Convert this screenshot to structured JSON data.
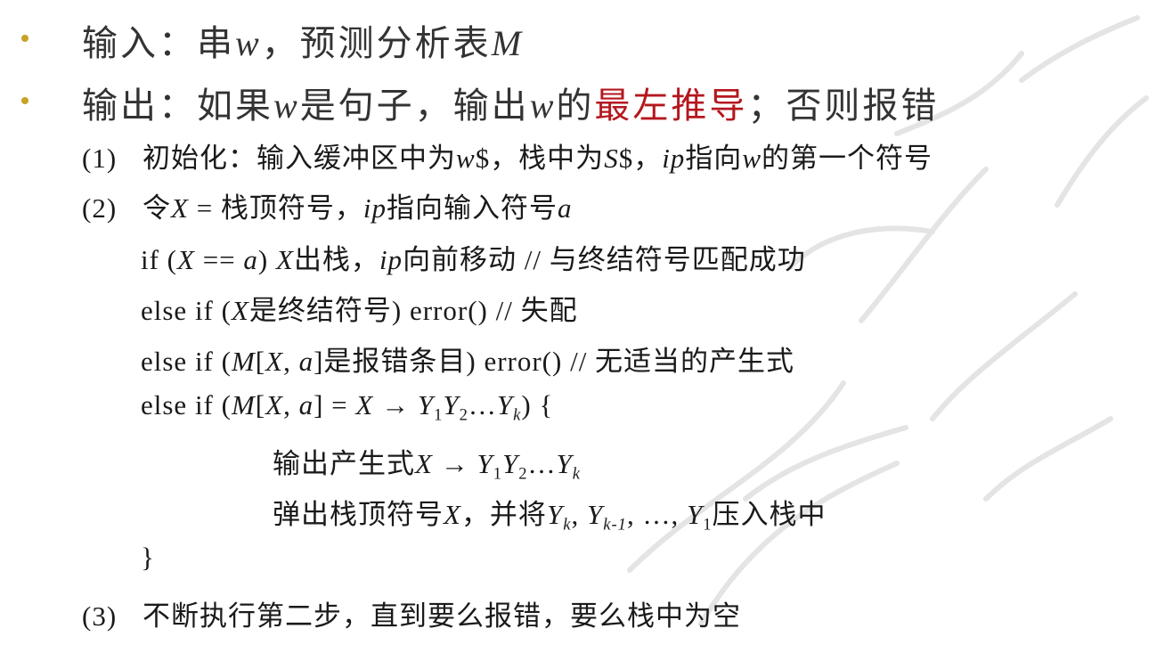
{
  "colors": {
    "bullet": "#c8a227",
    "emphasis": "#b5171e",
    "watermark": "#e4e4e4"
  },
  "bullets": [
    {
      "parts": [
        "输入：串",
        "w",
        "，预测分析表",
        "M"
      ]
    },
    {
      "parts": [
        "输出：如果",
        "w",
        "是句子，输出",
        "w",
        "的",
        "最左推导",
        "；否则报错"
      ]
    }
  ],
  "steps": {
    "s1": {
      "num": "(1)",
      "parts": [
        "初始化：输入缓冲区中为",
        "w",
        "$，栈中为",
        "S",
        "$，",
        "ip",
        "指向",
        "w",
        "的第一个符号"
      ]
    },
    "s2": {
      "num": "(2)",
      "parts": [
        "令",
        "X",
        " = 栈顶符号，",
        "ip",
        "指向输入符号",
        "a"
      ]
    },
    "l1": {
      "parts": [
        "if (",
        "X",
        " == ",
        "a",
        ") ",
        "X",
        "出栈，",
        "ip",
        "向前移动 // 与终结符号匹配成功"
      ]
    },
    "l2": {
      "parts": [
        "else if (",
        "X",
        "是终结符号) error() // 失配"
      ]
    },
    "l3": {
      "parts": [
        "else if (",
        "M",
        "[",
        "X",
        ", ",
        "a",
        "]是报错条目) error() // 无适当的产生式"
      ]
    },
    "l4": {
      "parts": [
        "else if (",
        "M",
        "[",
        "X",
        ", ",
        "a",
        "] = ",
        "X",
        " → ",
        "Y",
        "1",
        "Y",
        "2",
        "…",
        "Y",
        "k",
        ") {"
      ]
    },
    "l5": {
      "parts": [
        "输出产生式",
        "X",
        " → ",
        "Y",
        "1",
        "Y",
        "2",
        "…",
        "Y",
        "k"
      ]
    },
    "l6": {
      "parts": [
        "弹出栈顶符号",
        "X",
        "，并将",
        "Y",
        "k",
        ", ",
        "Y",
        "k-1",
        ", …, ",
        "Y",
        "1",
        "压入栈中"
      ]
    },
    "l7": {
      "parts": [
        "}"
      ]
    },
    "s3": {
      "num": "(3)",
      "parts": [
        "不断执行第二步，直到要么报错，要么栈中为空"
      ]
    }
  }
}
